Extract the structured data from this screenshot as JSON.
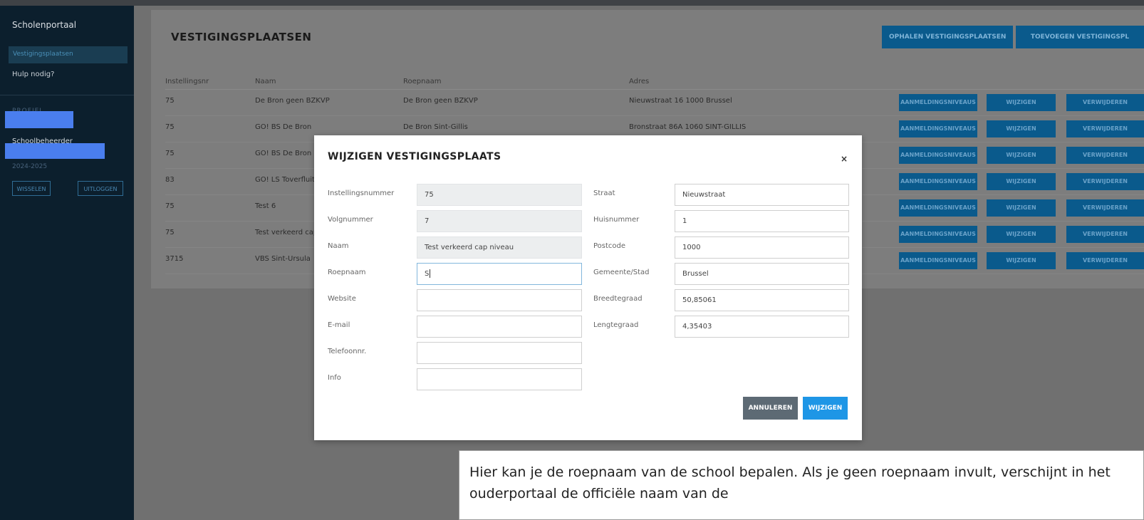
{
  "sidebar": {
    "title": "Scholenportaal",
    "active_item": "Vestigingsplaatsen",
    "help": "Hulp nodig?",
    "profile_label": "PROFIEL",
    "role": "Schoolbeheerder",
    "year": "2024-2025",
    "switch_button": "WISSELEN",
    "logout_button": "UITLOGGEN"
  },
  "header": {
    "title": "VESTIGINGSPLAATSEN",
    "fetch_button": "OPHALEN VESTIGINGSPLAATSEN",
    "add_button": "TOEVOEGEN VESTIGINGSPL"
  },
  "table": {
    "columns": [
      "Instellingsnr",
      "Naam",
      "Roepnaam",
      "Adres"
    ],
    "rows": [
      {
        "nr": "75",
        "naam": "De Bron geen BZKVP",
        "roepnaam": "De Bron geen BZKVP",
        "adres": "Nieuwstraat 16 1000 Brussel"
      },
      {
        "nr": "75",
        "naam": "GO! BS De Bron",
        "roepnaam": "De Bron Sint-Gillis",
        "adres": "Bronstraat 86A 1060 SINT-GILLIS"
      },
      {
        "nr": "75",
        "naam": "GO! BS De Bron",
        "roepnaam": "",
        "adres": ""
      },
      {
        "nr": "83",
        "naam": "GO! LS Toverfluit",
        "roepnaam": "",
        "adres": ""
      },
      {
        "nr": "75",
        "naam": "Test 6",
        "roepnaam": "",
        "adres": ""
      },
      {
        "nr": "75",
        "naam": "Test verkeerd cap",
        "roepnaam": "",
        "adres": ""
      },
      {
        "nr": "3715",
        "naam": "VBS Sint-Ursula",
        "roepnaam": "",
        "adres": ""
      }
    ],
    "row_buttons": {
      "levels": "AANMELDINGSNIVEAUS",
      "edit": "WIJZIGEN",
      "delete": "VERWIJDEREN"
    }
  },
  "modal": {
    "title": "WIJZIGEN VESTIGINGSPLAATS",
    "close": "×",
    "left_fields": [
      {
        "label": "Instellingsnummer",
        "value": "75"
      },
      {
        "label": "Volgnummer",
        "value": "7"
      },
      {
        "label": "Naam",
        "value": "Test verkeerd cap niveau"
      },
      {
        "label": "Roepnaam",
        "value": "S"
      },
      {
        "label": "Website",
        "value": ""
      },
      {
        "label": "E-mail",
        "value": ""
      },
      {
        "label": "Telefoonnr.",
        "value": ""
      },
      {
        "label": "Info",
        "value": ""
      }
    ],
    "right_fields": [
      {
        "label": "Straat",
        "value": "Nieuwstraat"
      },
      {
        "label": "Huisnummer",
        "value": "1"
      },
      {
        "label": "Postcode",
        "value": "1000"
      },
      {
        "label": "Gemeente/Stad",
        "value": "Brussel"
      },
      {
        "label": "Breedtegraad",
        "value": "50,85061"
      },
      {
        "label": "Lengtegraad",
        "value": "4,35403"
      }
    ],
    "cancel_button": "ANNULEREN",
    "submit_button": "WIJZIGEN"
  },
  "note": {
    "text": "Hier kan je de roepnaam van de school bepalen. Als je geen roepnaam invult, verschijnt in het ouderportaal  de officiële naam van de"
  },
  "colors": {
    "sidebar_bg": "#0c1f2d",
    "primary_button": "#1e96e6",
    "cancel_button": "#5d6a74",
    "overlay_bg": "#707070",
    "redaction": "#4a7eee"
  }
}
